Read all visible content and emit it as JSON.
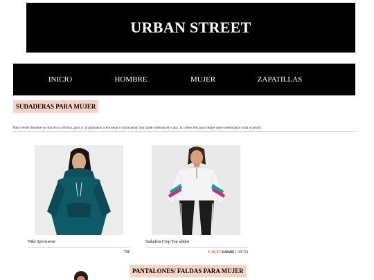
{
  "header": {
    "brand": "URBAN STREET"
  },
  "nav": {
    "items": [
      {
        "label": "INICIO"
      },
      {
        "label": "HOMBRE"
      },
      {
        "label": "MUJER"
      },
      {
        "label": "ZAPATILLAS"
      }
    ]
  },
  "sections": [
    {
      "title": "SUDADERAS PARA MUJER",
      "intro": "Para vestir durante un día en la oficina, para ir al gimnasio a entrenar o para pasar una tarde cómoda en casa, la colección para mujer que cuenta para cada ocasión.",
      "products": [
        {
          "name": "Nike Sportswear",
          "price": "70€"
        },
        {
          "name": "Sudadera Crop Top adidas",
          "sale_price": "€ 40,97",
          "old_price": "€ 69,95",
          "discount": "(-30 %)"
        }
      ]
    },
    {
      "title": "PANTALONES/ FALDAS PARA MUJER"
    }
  ],
  "colors": {
    "brand_bg": "#000000",
    "badge_bg": "#f8d2c2",
    "sale": "#d42020"
  }
}
